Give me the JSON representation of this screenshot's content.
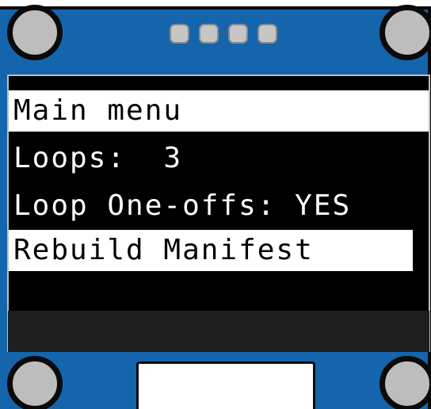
{
  "device": {
    "board_color": "#1565ad",
    "display_color": "#000000",
    "pixel_color": "#ffffff",
    "pin_count": 4
  },
  "menu": {
    "title": "Main menu",
    "items": [
      {
        "label": "Loops:  3"
      },
      {
        "label": "Loop One-offs: YES"
      },
      {
        "label": "Rebuild Manifest",
        "selected": true
      }
    ]
  }
}
